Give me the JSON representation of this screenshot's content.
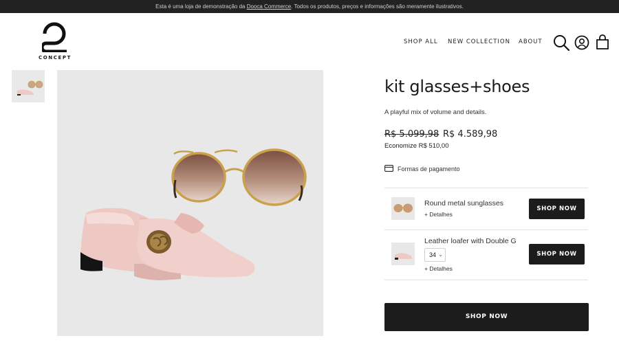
{
  "announcement": {
    "prefix": "Esta é uma loja de demonstração da ",
    "link": "Dooca Commerce",
    "suffix": ". Todos os produtos, preços e informações são meramente ilustrativos."
  },
  "logo": {
    "text": "CONCEPT"
  },
  "nav": {
    "shop_all": "SHOP ALL",
    "new_collection": "NEW COLLECTION",
    "about": "ABOUT"
  },
  "header_icons": [
    "search-icon",
    "user-icon",
    "bag-icon"
  ],
  "product": {
    "title": "kit glasses+shoes",
    "description": "A playful mix of volume and details.",
    "old_price": "R$ 5.099,98",
    "new_price": "R$ 4.589,98",
    "savings": "Economize R$ 510,00",
    "payment_label": "Formas de pagamento"
  },
  "kit_items": [
    {
      "name": "Round metal sunglasses",
      "details": "+ Detalhes",
      "button": "SHOP NOW"
    },
    {
      "name": "Leather loafer with Double G",
      "size": "34",
      "details": "+ Detalhes",
      "button": "SHOP NOW"
    }
  ],
  "main_button": "SHOP NOW",
  "colors": {
    "topbar": "#222222",
    "button": "#1c1c1c",
    "image_bg": "#e8e8e8",
    "shoe": "#f1cfcb"
  }
}
